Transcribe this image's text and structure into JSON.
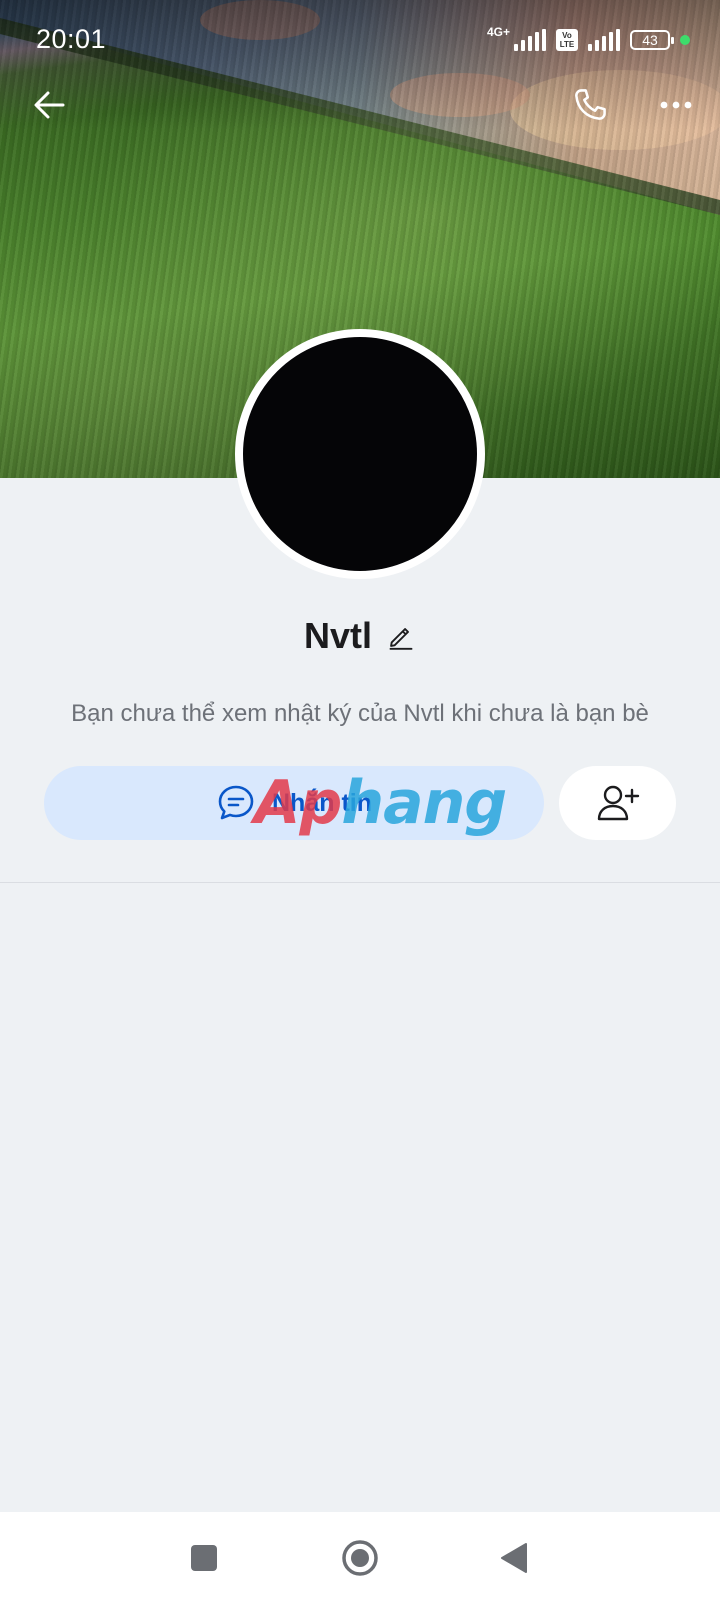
{
  "status_bar": {
    "time": "20:01",
    "network": "4G+",
    "volte": "Vo LTE",
    "battery": "43",
    "colors": {
      "dot": "#3ddc6b"
    }
  },
  "header": {
    "icons": [
      "back-arrow-icon",
      "phone-icon",
      "more-options-icon"
    ]
  },
  "profile": {
    "name": "Nvtl",
    "info": "Bạn chưa thể xem nhật ký của Nvtl khi chưa là bạn bè"
  },
  "actions": {
    "message_label": "Nhắn tin",
    "message_icon": "chat-bubble-icon",
    "add_friend_icon": "add-friend-icon",
    "colors": {
      "primary": "#0a57c9",
      "primary_bg": "#d9e8fd"
    }
  },
  "watermark": {
    "part1": "Ap",
    "part2": "hang"
  },
  "nav": {
    "icons": [
      "recents-square-icon",
      "home-circle-icon",
      "back-triangle-icon"
    ]
  }
}
